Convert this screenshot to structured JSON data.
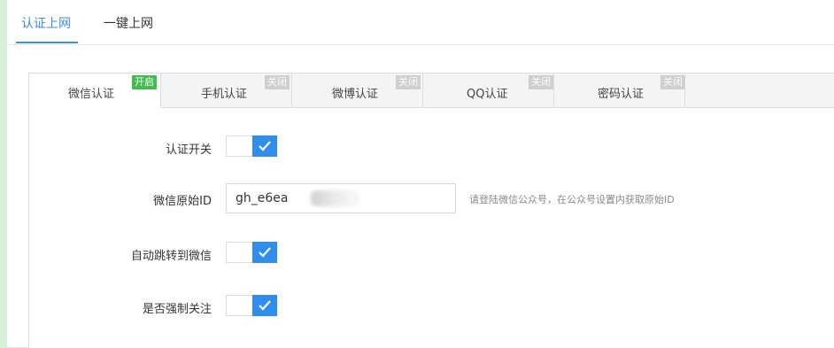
{
  "top_tabs": [
    {
      "label": "认证上网",
      "active": true
    },
    {
      "label": "一键上网",
      "active": false
    }
  ],
  "auth_tabs": [
    {
      "label": "微信认证",
      "badge": "开启",
      "active": true
    },
    {
      "label": "手机认证",
      "badge": "关闭",
      "active": false
    },
    {
      "label": "微博认证",
      "badge": "关闭",
      "active": false
    },
    {
      "label": "QQ认证",
      "badge": "关闭",
      "active": false
    },
    {
      "label": "密码认证",
      "badge": "关闭",
      "active": false
    }
  ],
  "form": {
    "auth_switch": {
      "label": "认证开关",
      "checked": true
    },
    "wechat_id": {
      "label": "微信原始ID",
      "value": "gh_e6ea",
      "hint": "请登陆微信公众号，在公众号设置内获取原始ID"
    },
    "auto_redirect": {
      "label": "自动跳转到微信",
      "checked": true
    },
    "force_follow": {
      "label": "是否强制关注",
      "checked": true
    }
  },
  "colors": {
    "accent": "#3a8ee6",
    "toggle_on": "#2e8ded",
    "badge_on": "#3fbe4e",
    "badge_off": "#cfcfcf",
    "outer_background": "#d6f2d6"
  },
  "icons": {
    "toggle_check": "check-icon"
  }
}
